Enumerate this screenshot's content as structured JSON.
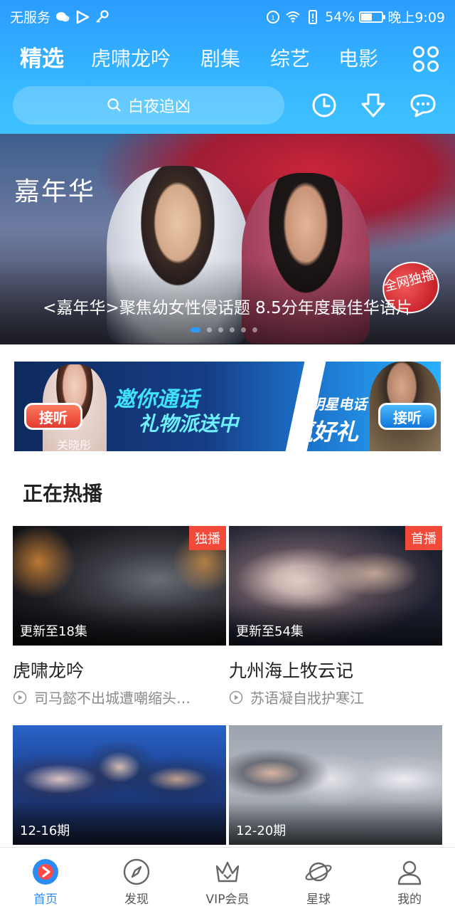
{
  "status_bar": {
    "carrier": "无服务",
    "battery": "54%",
    "battery_level": 0.54,
    "time": "晚上9:09"
  },
  "tabs": [
    {
      "label": "精选",
      "active": true
    },
    {
      "label": "虎啸龙吟",
      "active": false
    },
    {
      "label": "剧集",
      "active": false
    },
    {
      "label": "综艺",
      "active": false
    },
    {
      "label": "电影",
      "active": false
    }
  ],
  "search": {
    "placeholder": "白夜追凶"
  },
  "header_icons": [
    "history-icon",
    "download-icon",
    "message-icon"
  ],
  "banner": {
    "logo_text": "嘉年华",
    "caption": "<嘉年华>聚焦幼女性侵话题 8.5分年度最佳华语片",
    "seal_text": "全网独播",
    "dot_count": 6,
    "active_dot": 0
  },
  "promo": {
    "slogan_line1": "邀你通话",
    "slogan_line2": "礼物派送中",
    "slogan_right1": "接明星电话",
    "slogan_right2": "赢好礼",
    "answer_label": "接听",
    "star_name": "关晓彤"
  },
  "section": {
    "title": "正在热播"
  },
  "cards": [
    {
      "title": "虎啸龙吟",
      "subtitle": "司马懿不出城遭嘲缩头…",
      "update": "更新至18集",
      "tag": "独播"
    },
    {
      "title": "九州海上牧云记",
      "subtitle": "苏语凝自戕护寒江",
      "update": "更新至54集",
      "tag": "首播"
    },
    {
      "title": "",
      "subtitle": "",
      "update": "12-16期",
      "tag": ""
    },
    {
      "title": "",
      "subtitle": "",
      "update": "12-20期",
      "tag": ""
    }
  ],
  "bottom_nav": [
    {
      "label": "首页",
      "icon": "home-icon",
      "active": true
    },
    {
      "label": "发现",
      "icon": "compass-icon",
      "active": false
    },
    {
      "label": "VIP会员",
      "icon": "crown-icon",
      "active": false
    },
    {
      "label": "星球",
      "icon": "planet-icon",
      "active": false
    },
    {
      "label": "我的",
      "icon": "profile-icon",
      "active": false
    }
  ],
  "colors": {
    "brand": "#2a9cff",
    "tag_red": "#f24a3a",
    "nav_active": "#2a8cf5"
  }
}
